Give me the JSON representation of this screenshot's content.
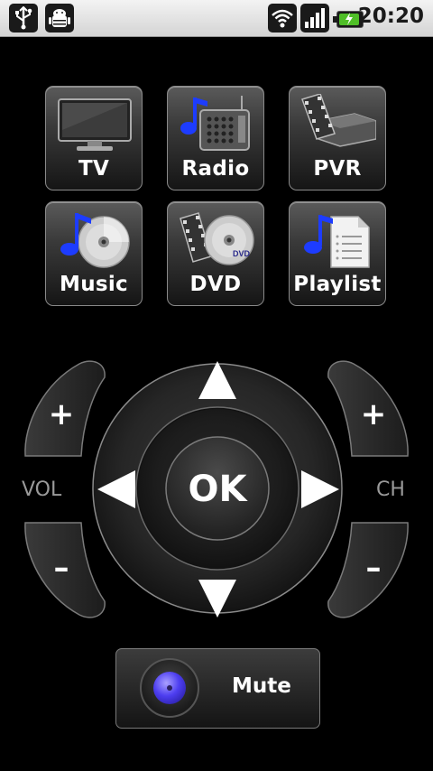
{
  "status_bar": {
    "time": "20:20",
    "icons": [
      "usb-icon",
      "android-debug-icon",
      "wifi-icon",
      "signal-icon",
      "battery-charging-icon"
    ]
  },
  "sources": [
    {
      "label": "TV",
      "icon": "tv-icon"
    },
    {
      "label": "Radio",
      "icon": "radio-icon"
    },
    {
      "label": "PVR",
      "icon": "pvr-icon"
    },
    {
      "label": "Music",
      "icon": "music-icon"
    },
    {
      "label": "DVD",
      "icon": "dvd-icon"
    },
    {
      "label": "Playlist",
      "icon": "playlist-icon"
    }
  ],
  "volume": {
    "label": "VOL",
    "plus": "+",
    "minus": "–"
  },
  "channel": {
    "label": "CH",
    "plus": "+",
    "minus": "–"
  },
  "dpad": {
    "ok_label": "OK"
  },
  "mute": {
    "label": "Mute"
  },
  "colors": {
    "accent_blue": "#3b2ee6",
    "background": "#000000"
  }
}
